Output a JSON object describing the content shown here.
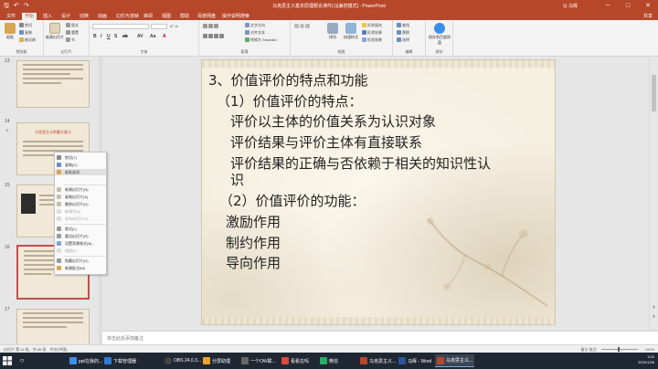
{
  "window": {
    "title": "马克思主义基本原理概论课件(1)[兼容模式] - PowerPoint",
    "user": "马 马辉",
    "controls": [
      "─",
      "□",
      "✕"
    ]
  },
  "ribbon_tabs": [
    {
      "label": "文件"
    },
    {
      "label": "开始",
      "active": true
    },
    {
      "label": "插入"
    },
    {
      "label": "设计"
    },
    {
      "label": "切换"
    },
    {
      "label": "动画"
    },
    {
      "label": "幻灯片放映"
    },
    {
      "label": "审阅"
    },
    {
      "label": "视图"
    },
    {
      "label": "帮助"
    },
    {
      "label": "百度网盘"
    },
    {
      "label": "操作说明搜索"
    }
  ],
  "share_label": "共享",
  "ribbon": {
    "clipboard": {
      "paste": "粘贴",
      "cut": "剪切",
      "copy": "复制",
      "format_painter": "格式刷",
      "label": "剪贴板"
    },
    "slides": {
      "new_slide": "新建幻灯片",
      "layout": "版式",
      "reset": "重置",
      "section": "节",
      "label": "幻灯片"
    },
    "font": {
      "label": "字体"
    },
    "paragraph": {
      "label": "段落",
      "text_direction": "文字方向",
      "align_text": "对齐文本",
      "convert_smartart": "转换为 SmartArt"
    },
    "drawing": {
      "arrange": "排列",
      "quick_styles": "快速样式",
      "shape_fill": "形状填充",
      "shape_outline": "形状轮廓",
      "shape_effects": "形状效果",
      "label": "绘图"
    },
    "editing": {
      "find": "查找",
      "replace": "替换",
      "select": "选择",
      "label": "编辑"
    },
    "save": {
      "button": "保存到百度网盘",
      "label": "保存"
    }
  },
  "thumbnails": [
    {
      "number": "13"
    },
    {
      "number": "14",
      "title": "马克思主义的重大意义"
    },
    {
      "number": "15"
    },
    {
      "number": "16"
    },
    {
      "number": "17"
    }
  ],
  "context_menu": [
    {
      "label": "剪切(T)"
    },
    {
      "label": "复制(C)"
    },
    {
      "label": "粘贴选项:",
      "highlighted": true
    },
    {
      "label": "新建幻灯片(N)"
    },
    {
      "label": "复制幻灯片(A)"
    },
    {
      "label": "删除幻灯片(D)"
    },
    {
      "label": "新增节(A)",
      "disabled": true
    },
    {
      "label": "发布幻灯片(S)",
      "disabled": true
    },
    {
      "label": "版式(L)"
    },
    {
      "label": "重设幻灯片(R)"
    },
    {
      "label": "设置背景格式(B)..."
    },
    {
      "label": "相册(P)...",
      "disabled": true
    },
    {
      "label": "隐藏幻灯片(H)"
    },
    {
      "label": "新建批注(M)"
    }
  ],
  "slide": {
    "lines": [
      "3、价值评价的特点和功能",
      "（1）价值评价的特点：",
      "评价以主体的价值关系为认识对象",
      "评价结果与评价主体有直接联系",
      "评价结果的正确与否依赖于相关的知识性认",
      "识",
      "（2）价值评价的功能：",
      "激励作用",
      "制约作用",
      "导向作用"
    ]
  },
  "notes_placeholder": "单击此处添加备注",
  "status": {
    "slide_info": "幻灯片 第 16 张，共 88 张",
    "language": "中文(中国)",
    "notes": "备注",
    "comments": "批注",
    "zoom": "100%"
  },
  "taskbar": {
    "items": [
      {
        "label": "ppt在我的..."
      },
      {
        "label": "下载管理器"
      },
      {
        "label": "OBS 24.0.3..."
      },
      {
        "label": "分屏助理"
      },
      {
        "label": "一个OW联..."
      },
      {
        "label": "看看在吗"
      },
      {
        "label": "微信"
      },
      {
        "label": "马克思主义..."
      },
      {
        "label": "马辉 - Word"
      },
      {
        "label": "马克思主义..."
      }
    ],
    "time": "1:02",
    "date": "2020/12/8"
  },
  "colors": {
    "accent": "#b7472a",
    "slide_background": "#f5efe0"
  }
}
